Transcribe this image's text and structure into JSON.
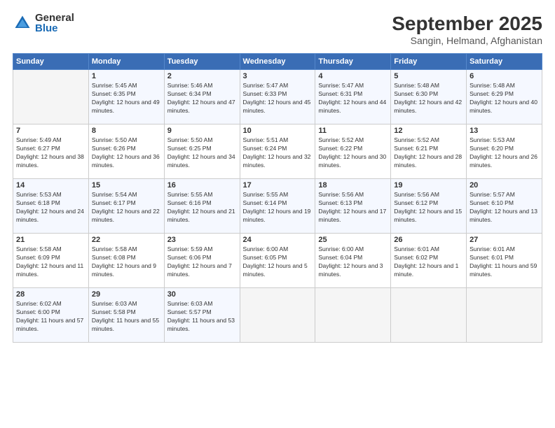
{
  "header": {
    "logo_general": "General",
    "logo_blue": "Blue",
    "month_title": "September 2025",
    "location": "Sangin, Helmand, Afghanistan"
  },
  "days_of_week": [
    "Sunday",
    "Monday",
    "Tuesday",
    "Wednesday",
    "Thursday",
    "Friday",
    "Saturday"
  ],
  "weeks": [
    [
      {
        "num": "",
        "sunrise": "",
        "sunset": "",
        "daylight": "",
        "empty": true
      },
      {
        "num": "1",
        "sunrise": "Sunrise: 5:45 AM",
        "sunset": "Sunset: 6:35 PM",
        "daylight": "Daylight: 12 hours and 49 minutes."
      },
      {
        "num": "2",
        "sunrise": "Sunrise: 5:46 AM",
        "sunset": "Sunset: 6:34 PM",
        "daylight": "Daylight: 12 hours and 47 minutes."
      },
      {
        "num": "3",
        "sunrise": "Sunrise: 5:47 AM",
        "sunset": "Sunset: 6:33 PM",
        "daylight": "Daylight: 12 hours and 45 minutes."
      },
      {
        "num": "4",
        "sunrise": "Sunrise: 5:47 AM",
        "sunset": "Sunset: 6:31 PM",
        "daylight": "Daylight: 12 hours and 44 minutes."
      },
      {
        "num": "5",
        "sunrise": "Sunrise: 5:48 AM",
        "sunset": "Sunset: 6:30 PM",
        "daylight": "Daylight: 12 hours and 42 minutes."
      },
      {
        "num": "6",
        "sunrise": "Sunrise: 5:48 AM",
        "sunset": "Sunset: 6:29 PM",
        "daylight": "Daylight: 12 hours and 40 minutes."
      }
    ],
    [
      {
        "num": "7",
        "sunrise": "Sunrise: 5:49 AM",
        "sunset": "Sunset: 6:27 PM",
        "daylight": "Daylight: 12 hours and 38 minutes."
      },
      {
        "num": "8",
        "sunrise": "Sunrise: 5:50 AM",
        "sunset": "Sunset: 6:26 PM",
        "daylight": "Daylight: 12 hours and 36 minutes."
      },
      {
        "num": "9",
        "sunrise": "Sunrise: 5:50 AM",
        "sunset": "Sunset: 6:25 PM",
        "daylight": "Daylight: 12 hours and 34 minutes."
      },
      {
        "num": "10",
        "sunrise": "Sunrise: 5:51 AM",
        "sunset": "Sunset: 6:24 PM",
        "daylight": "Daylight: 12 hours and 32 minutes."
      },
      {
        "num": "11",
        "sunrise": "Sunrise: 5:52 AM",
        "sunset": "Sunset: 6:22 PM",
        "daylight": "Daylight: 12 hours and 30 minutes."
      },
      {
        "num": "12",
        "sunrise": "Sunrise: 5:52 AM",
        "sunset": "Sunset: 6:21 PM",
        "daylight": "Daylight: 12 hours and 28 minutes."
      },
      {
        "num": "13",
        "sunrise": "Sunrise: 5:53 AM",
        "sunset": "Sunset: 6:20 PM",
        "daylight": "Daylight: 12 hours and 26 minutes."
      }
    ],
    [
      {
        "num": "14",
        "sunrise": "Sunrise: 5:53 AM",
        "sunset": "Sunset: 6:18 PM",
        "daylight": "Daylight: 12 hours and 24 minutes."
      },
      {
        "num": "15",
        "sunrise": "Sunrise: 5:54 AM",
        "sunset": "Sunset: 6:17 PM",
        "daylight": "Daylight: 12 hours and 22 minutes."
      },
      {
        "num": "16",
        "sunrise": "Sunrise: 5:55 AM",
        "sunset": "Sunset: 6:16 PM",
        "daylight": "Daylight: 12 hours and 21 minutes."
      },
      {
        "num": "17",
        "sunrise": "Sunrise: 5:55 AM",
        "sunset": "Sunset: 6:14 PM",
        "daylight": "Daylight: 12 hours and 19 minutes."
      },
      {
        "num": "18",
        "sunrise": "Sunrise: 5:56 AM",
        "sunset": "Sunset: 6:13 PM",
        "daylight": "Daylight: 12 hours and 17 minutes."
      },
      {
        "num": "19",
        "sunrise": "Sunrise: 5:56 AM",
        "sunset": "Sunset: 6:12 PM",
        "daylight": "Daylight: 12 hours and 15 minutes."
      },
      {
        "num": "20",
        "sunrise": "Sunrise: 5:57 AM",
        "sunset": "Sunset: 6:10 PM",
        "daylight": "Daylight: 12 hours and 13 minutes."
      }
    ],
    [
      {
        "num": "21",
        "sunrise": "Sunrise: 5:58 AM",
        "sunset": "Sunset: 6:09 PM",
        "daylight": "Daylight: 12 hours and 11 minutes."
      },
      {
        "num": "22",
        "sunrise": "Sunrise: 5:58 AM",
        "sunset": "Sunset: 6:08 PM",
        "daylight": "Daylight: 12 hours and 9 minutes."
      },
      {
        "num": "23",
        "sunrise": "Sunrise: 5:59 AM",
        "sunset": "Sunset: 6:06 PM",
        "daylight": "Daylight: 12 hours and 7 minutes."
      },
      {
        "num": "24",
        "sunrise": "Sunrise: 6:00 AM",
        "sunset": "Sunset: 6:05 PM",
        "daylight": "Daylight: 12 hours and 5 minutes."
      },
      {
        "num": "25",
        "sunrise": "Sunrise: 6:00 AM",
        "sunset": "Sunset: 6:04 PM",
        "daylight": "Daylight: 12 hours and 3 minutes."
      },
      {
        "num": "26",
        "sunrise": "Sunrise: 6:01 AM",
        "sunset": "Sunset: 6:02 PM",
        "daylight": "Daylight: 12 hours and 1 minute."
      },
      {
        "num": "27",
        "sunrise": "Sunrise: 6:01 AM",
        "sunset": "Sunset: 6:01 PM",
        "daylight": "Daylight: 11 hours and 59 minutes."
      }
    ],
    [
      {
        "num": "28",
        "sunrise": "Sunrise: 6:02 AM",
        "sunset": "Sunset: 6:00 PM",
        "daylight": "Daylight: 11 hours and 57 minutes."
      },
      {
        "num": "29",
        "sunrise": "Sunrise: 6:03 AM",
        "sunset": "Sunset: 5:58 PM",
        "daylight": "Daylight: 11 hours and 55 minutes."
      },
      {
        "num": "30",
        "sunrise": "Sunrise: 6:03 AM",
        "sunset": "Sunset: 5:57 PM",
        "daylight": "Daylight: 11 hours and 53 minutes."
      },
      {
        "num": "",
        "sunrise": "",
        "sunset": "",
        "daylight": "",
        "empty": true
      },
      {
        "num": "",
        "sunrise": "",
        "sunset": "",
        "daylight": "",
        "empty": true
      },
      {
        "num": "",
        "sunrise": "",
        "sunset": "",
        "daylight": "",
        "empty": true
      },
      {
        "num": "",
        "sunrise": "",
        "sunset": "",
        "daylight": "",
        "empty": true
      }
    ]
  ]
}
